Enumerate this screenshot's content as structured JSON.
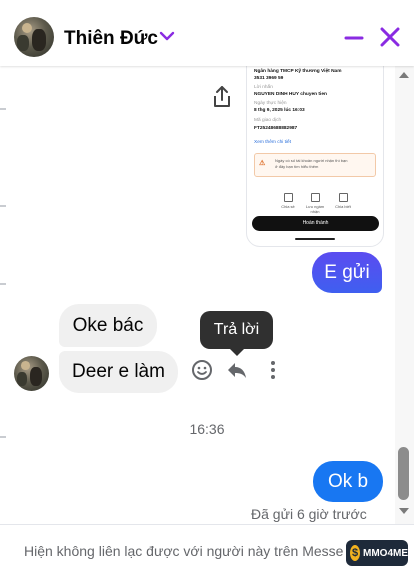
{
  "header": {
    "contact_name": "Thiên Đức",
    "icons": [
      "chevron-down-icon",
      "minimize-icon",
      "close-icon"
    ],
    "accent_color": "#8a2be2"
  },
  "receipt": {
    "bank_name": "Ngân hàng TMCP Kỹ thương Việt Nam",
    "account_no": "3531 3969 59",
    "message_label": "Lời nhắn",
    "message_value": "NGUYEN DINH HUY chuyen tien",
    "date_label": "Ngày thực hiện",
    "date_value": "8 thg 9, 2025 lúc 16:03",
    "tx_label": "Mã giao dịch",
    "tx_value": "FT25248688882987",
    "view_more": "Xem thêm chi tiết",
    "warning_badge": "⚠",
    "warning_text_1": "Ngày có số tài khoản người nhận thì bạn",
    "warning_text_2": "ở đây bạn tìm hiểu thêm",
    "actions": [
      "Chia sẻ",
      "Lưu ngầm nhận",
      "Chia biết"
    ],
    "done_label": "Hoàn thành"
  },
  "messages": {
    "out_1": "E gửi",
    "in_1": "Oke bác",
    "in_2": "Deer e làm",
    "time_divider": "16:36",
    "out_2": "Ok b",
    "seen_status": "Đã gửi 6 giờ trước"
  },
  "hover_actions": {
    "tooltip": "Trả lời",
    "icons": [
      "emoji-icon",
      "reply-icon",
      "more-icon"
    ]
  },
  "footer": {
    "notice": "Hiện không liên lạc được với người này trên Messenger."
  },
  "watermark": {
    "coin": "$",
    "label": "MMO4ME"
  },
  "colors": {
    "outgoing_bubble": "#5b4cf0",
    "outgoing_bubble_2": "#1877f2",
    "incoming_bubble": "#f0f0f0",
    "tooltip_bg": "#303030"
  }
}
